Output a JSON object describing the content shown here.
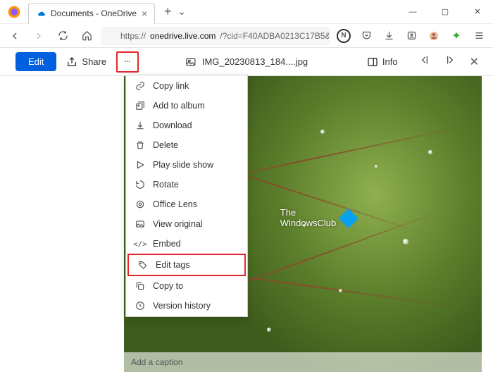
{
  "browser": {
    "tab_title": "Documents - OneDrive",
    "url_prefix": "https://",
    "url_domain": "onedrive.live.com",
    "url_path": "/?cid=F40ADBA0213C17B5&"
  },
  "toolbar": {
    "edit_label": "Edit",
    "share_label": "Share",
    "filename": "IMG_20230813_184....jpg",
    "info_label": "Info"
  },
  "menu": {
    "items": [
      {
        "icon": "link-icon",
        "label": "Copy link"
      },
      {
        "icon": "album-icon",
        "label": "Add to album"
      },
      {
        "icon": "download-icon",
        "label": "Download"
      },
      {
        "icon": "delete-icon",
        "label": "Delete"
      },
      {
        "icon": "play-icon",
        "label": "Play slide show"
      },
      {
        "icon": "rotate-icon",
        "label": "Rotate"
      },
      {
        "icon": "lens-icon",
        "label": "Office Lens"
      },
      {
        "icon": "view-icon",
        "label": "View original"
      },
      {
        "icon": "embed-icon",
        "label": "Embed"
      },
      {
        "icon": "tag-icon",
        "label": "Edit tags",
        "highlight": true
      },
      {
        "icon": "copyto-icon",
        "label": "Copy to"
      },
      {
        "icon": "history-icon",
        "label": "Version history"
      }
    ]
  },
  "watermark": {
    "line1": "The",
    "line2": "WindowsClub"
  },
  "caption": {
    "placeholder": "Add a caption"
  }
}
